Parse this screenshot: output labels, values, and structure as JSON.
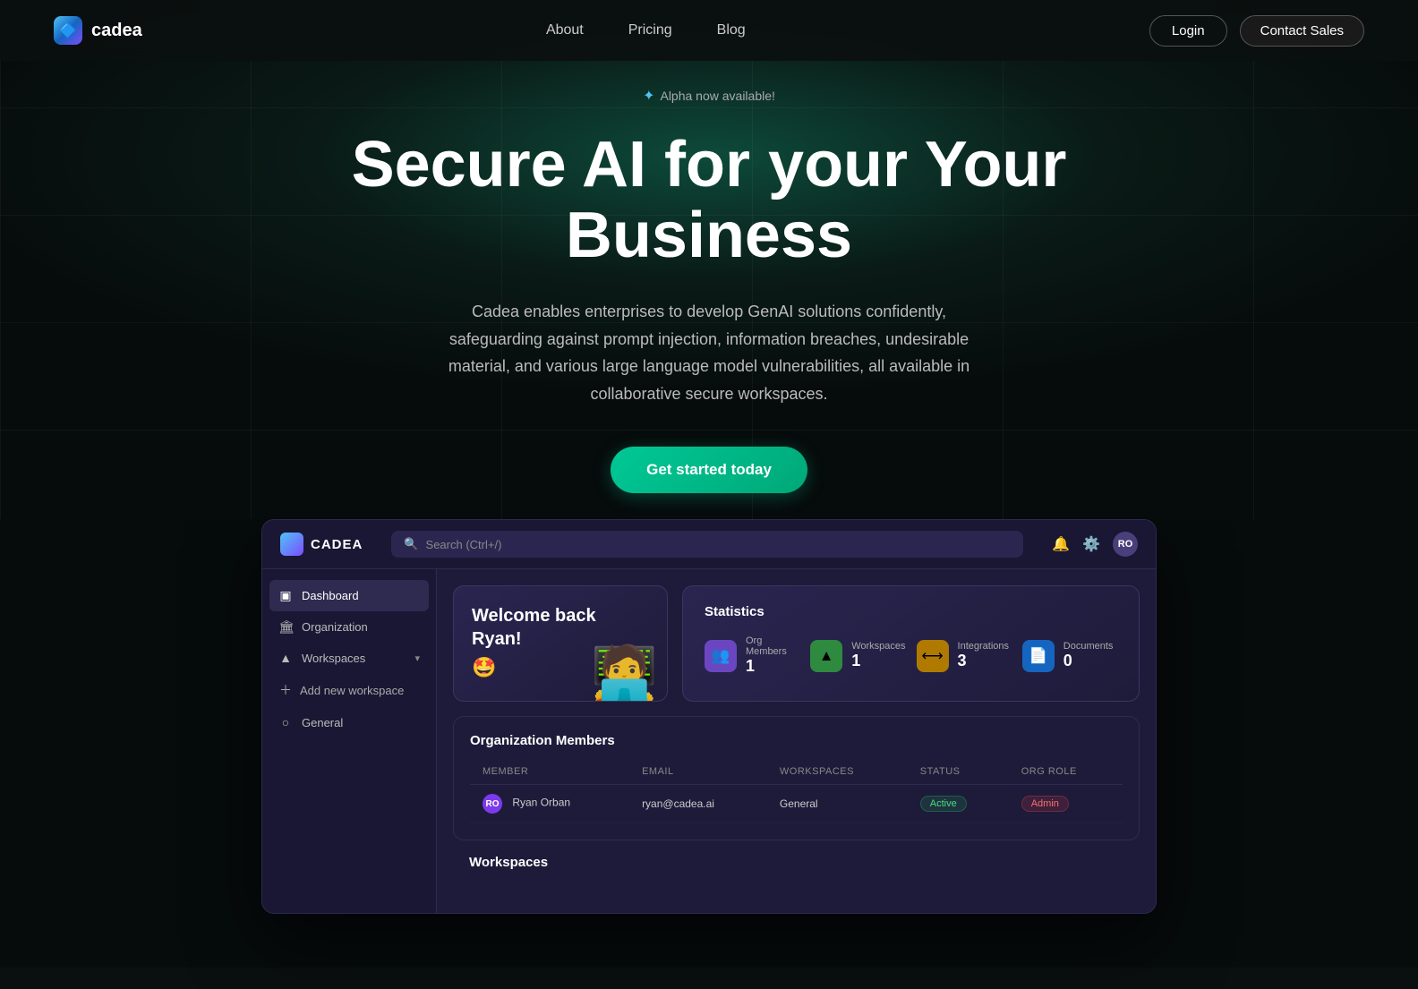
{
  "nav": {
    "logo_text": "cadea",
    "links": [
      "About",
      "Pricing",
      "Blog"
    ],
    "btn_login": "Login",
    "btn_contact": "Contact Sales"
  },
  "hero": {
    "badge": "Alpha now available!",
    "title_line1": "Secure AI for your Your",
    "title_line2": "Business",
    "subtitle": "Cadea enables enterprises to develop GenAI solutions confidently, safeguarding against prompt injection, information breaches, undesirable material, and various large language model vulnerabilities, all available in collaborative secure workspaces.",
    "cta": "Get started today"
  },
  "dashboard": {
    "logo": "CADEA",
    "search_placeholder": "Search (Ctrl+/)",
    "avatar_initials": "RO",
    "sidebar": {
      "items": [
        {
          "label": "Dashboard",
          "icon": "▣",
          "active": true
        },
        {
          "label": "Organization",
          "icon": "🏛",
          "active": false
        },
        {
          "label": "Workspaces",
          "icon": "🔺",
          "active": false,
          "has_chevron": true
        },
        {
          "label": "Add new workspace",
          "icon": "+",
          "active": false,
          "is_add": true
        },
        {
          "label": "General",
          "icon": "○",
          "active": false
        }
      ]
    },
    "welcome": {
      "text": "Welcome back Ryan!",
      "emoji": "🤩"
    },
    "stats": {
      "title": "Statistics",
      "items": [
        {
          "label": "Org Members",
          "value": "1",
          "icon": "👥",
          "color": "purple"
        },
        {
          "label": "Workspaces",
          "value": "1",
          "icon": "🔺",
          "color": "green"
        },
        {
          "label": "Integrations",
          "value": "3",
          "icon": "⟷",
          "color": "amber"
        },
        {
          "label": "Documents",
          "value": "0",
          "icon": "📄",
          "color": "blue"
        }
      ]
    },
    "members": {
      "title": "Organization Members",
      "columns": [
        "Member",
        "Email",
        "Workspaces",
        "Status",
        "Org Role"
      ],
      "rows": [
        {
          "initials": "RO",
          "name": "Ryan Orban",
          "email": "ryan@cadea.ai",
          "workspace": "General",
          "status": "Active",
          "role": "Admin"
        }
      ]
    },
    "workspaces_section_title": "Workspaces"
  }
}
